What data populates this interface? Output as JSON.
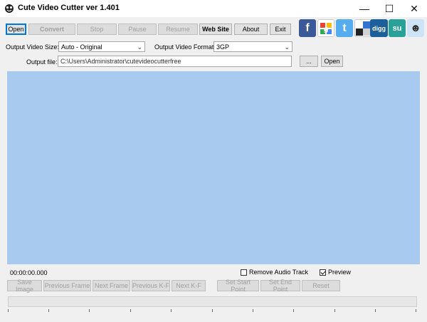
{
  "window": {
    "title": "Cute Video Cutter ver 1.401",
    "controls": {
      "minimize": "—",
      "maximize": "☐",
      "close": "✕"
    }
  },
  "toolbar": {
    "open": "Open",
    "convert": "Convert",
    "stop": "Stop",
    "pause": "Pause",
    "resume": "Resume",
    "website": "Web Site",
    "about": "About",
    "exit": "Exit"
  },
  "social": [
    {
      "icon": "facebook-icon",
      "glyph": "f",
      "color": "#3b5998"
    },
    {
      "icon": "google-icon",
      "glyph": "g",
      "color": "#dd4b39"
    },
    {
      "icon": "twitter-icon",
      "glyph": "t",
      "color": "#55acee"
    },
    {
      "icon": "delicious-icon",
      "glyph": "",
      "color": "#3274d1"
    },
    {
      "icon": "digg-icon",
      "glyph": "digg",
      "color": "#1d5f9a"
    },
    {
      "icon": "stumbleupon-icon",
      "glyph": "su",
      "color": "#2aa198"
    },
    {
      "icon": "reddit-icon",
      "glyph": "☻",
      "color": "#cee3f8"
    }
  ],
  "output": {
    "size_label": "Output Video Size:",
    "size_value": "Auto - Original",
    "format_label": "Output Video Format:",
    "format_value": "3GP",
    "file_label": "Output file:",
    "file_value": "C:\\Users\\Administrator\\cutevideocutterfree",
    "browse": "...",
    "open": "Open"
  },
  "player": {
    "timecode": "00:00:00.000",
    "remove_audio_label": "Remove Audio Track",
    "remove_audio_checked": false,
    "preview_label": "Preview",
    "preview_checked": true
  },
  "controls": {
    "save_image": "Save Image",
    "previous_frame": "Previous Frame",
    "next_frame": "Next Frame",
    "previous_kf": "Previous K-F",
    "next_kf": "Next K-F",
    "set_start": "Set  Start Point",
    "set_end": "Set  End Point",
    "reset": "Reset"
  },
  "colors": {
    "video_bg": "#a8caef",
    "focus": "#0078d7"
  }
}
